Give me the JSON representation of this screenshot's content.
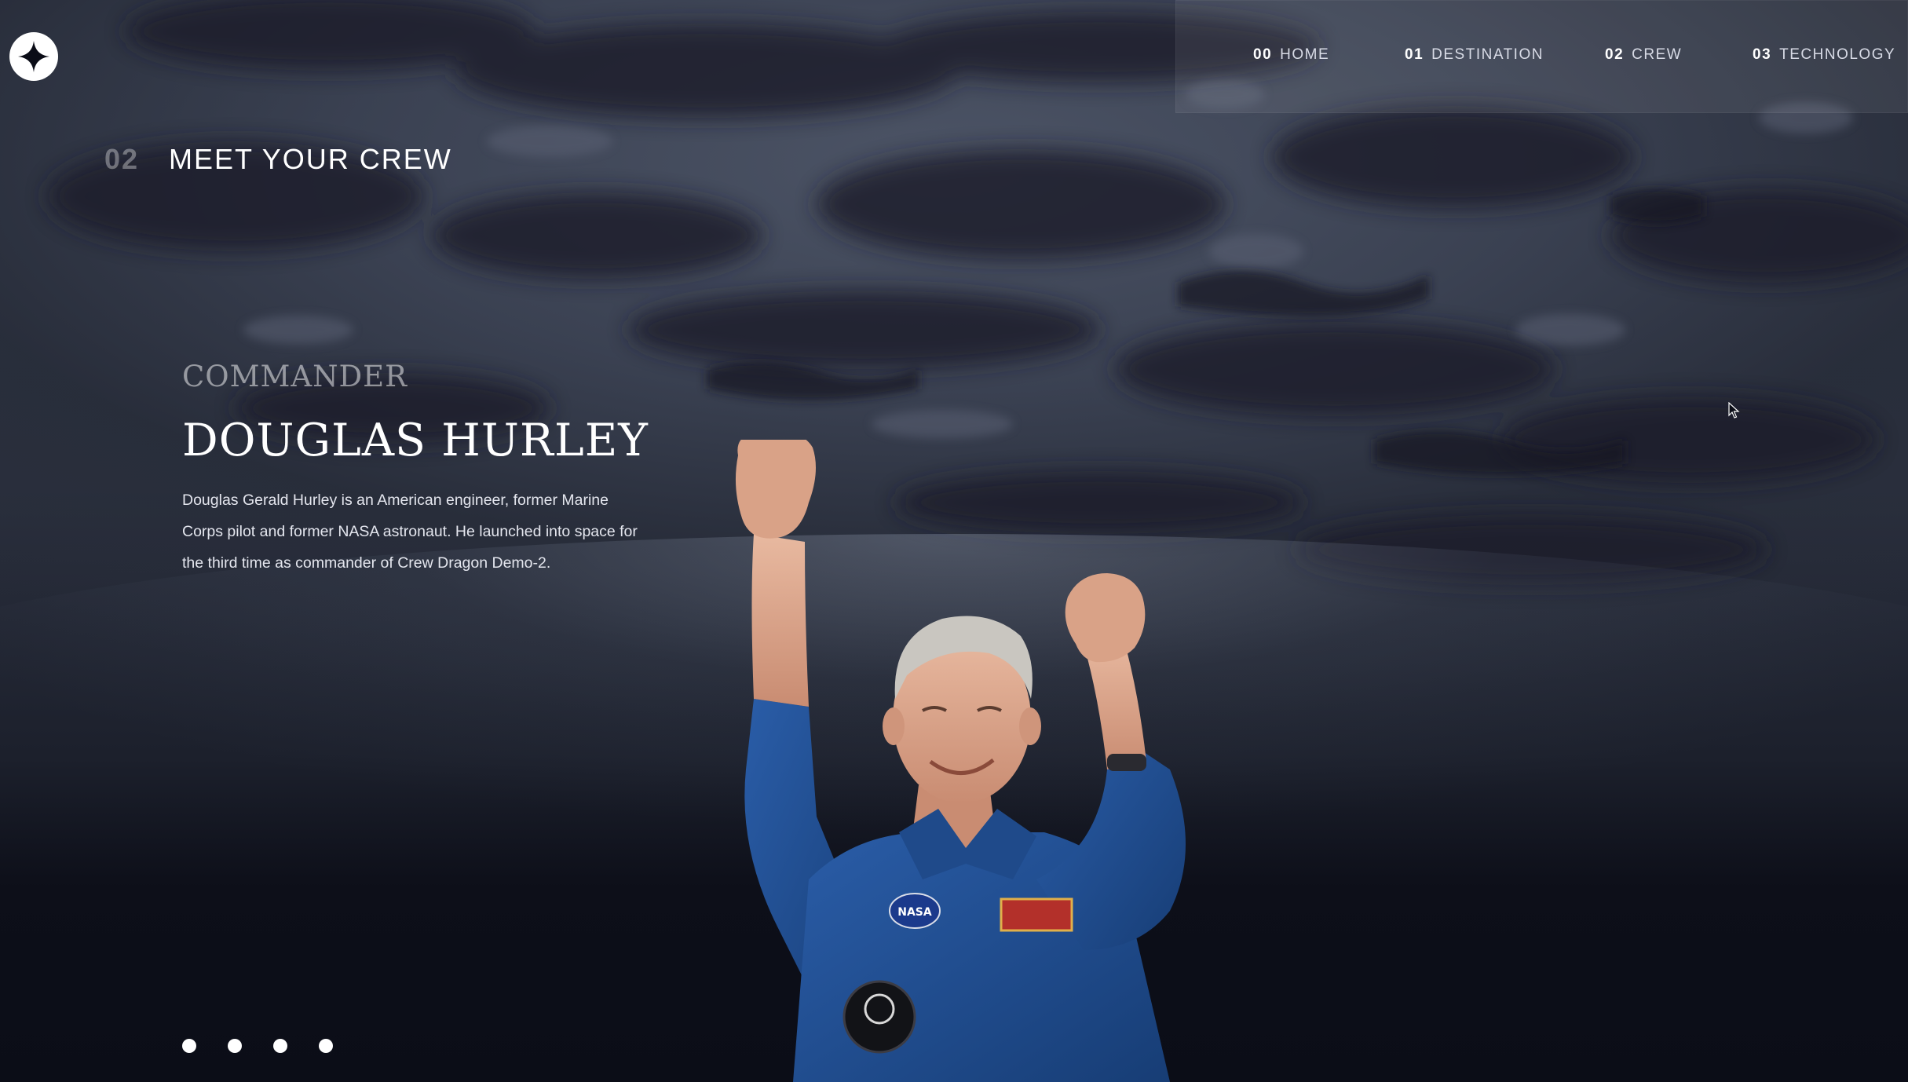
{
  "nav": {
    "items": [
      {
        "num": "00",
        "label": "HOME"
      },
      {
        "num": "01",
        "label": "DESTINATION"
      },
      {
        "num": "02",
        "label": "CREW"
      },
      {
        "num": "03",
        "label": "TECHNOLOGY"
      }
    ]
  },
  "heading": {
    "num": "02",
    "text": "MEET YOUR CREW"
  },
  "crew": {
    "role": "COMMANDER",
    "name": "DOUGLAS HURLEY",
    "bio": "Douglas Gerald Hurley is an American engineer, former Marine Corps pilot and former NASA astronaut. He launched into space for the third time as commander of Crew Dragon Demo-2."
  },
  "carousel": {
    "count": 4,
    "active_index": 0
  },
  "colors": {
    "background": "#0b0d17",
    "nav_text": "#d0d6f9",
    "suit_blue": "#1f4f8f"
  },
  "icons": {
    "logo": "four-point-star-logo-icon"
  }
}
